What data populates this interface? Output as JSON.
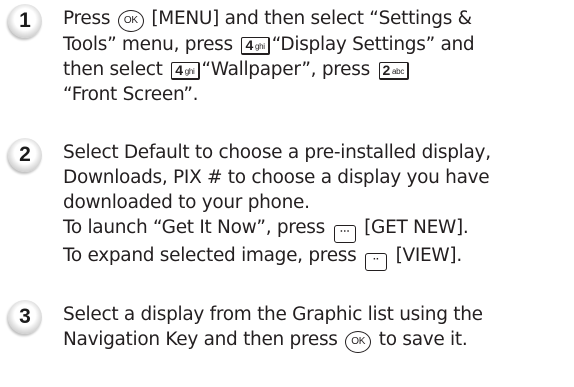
{
  "steps": [
    {
      "number": "1",
      "lines": [
        [
          "Press ",
          {
            "key": "ok",
            "label": "OK"
          },
          " [MENU] and then select “Settings &"
        ],
        [
          "Tools” menu, press ",
          {
            "key": "num",
            "label": "4",
            "sub": "ghi"
          },
          "“Display Settings” and"
        ],
        [
          "then select ",
          {
            "key": "num",
            "label": "4",
            "sub": "ghi"
          },
          "“Wallpaper”, press ",
          {
            "key": "num",
            "label": "2",
            "sub": "abc"
          }
        ],
        [
          "“Front Screen”."
        ]
      ]
    },
    {
      "number": "2",
      "lines": [
        [
          "Select Default to choose a pre-installed display,"
        ],
        [
          "Downloads, PIX # to choose a display you have"
        ],
        [
          "downloaded to your phone."
        ],
        [
          "To launch “Get It Now”, press ",
          {
            "key": "soft",
            "label": "⋯"
          },
          " [GET NEW]."
        ],
        [
          "To expand selected image, press ",
          {
            "key": "soft",
            "label": "··"
          },
          " [VIEW]."
        ]
      ]
    },
    {
      "number": "3",
      "lines": [
        [
          "Select a display from the Graphic list using the"
        ],
        [
          "Navigation Key and then press ",
          {
            "key": "ok",
            "label": "OK"
          },
          " to save it."
        ]
      ]
    }
  ]
}
